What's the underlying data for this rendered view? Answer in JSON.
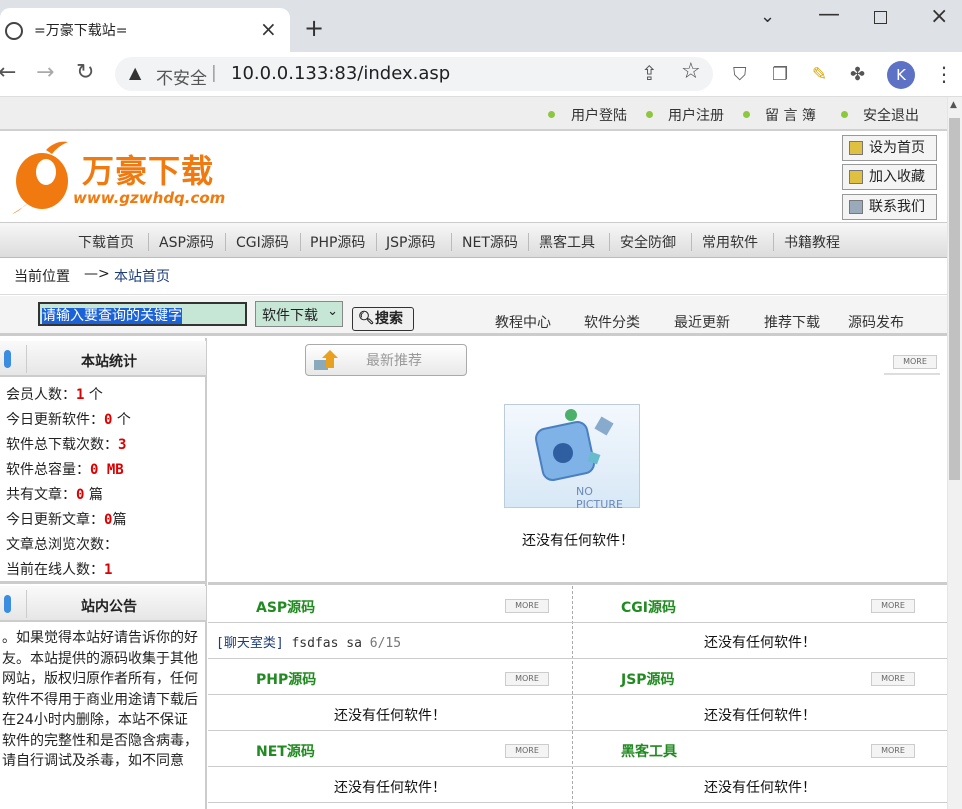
{
  "browser": {
    "tab_title": "=万豪下载站=",
    "insecure_label": "不安全",
    "url": "10.0.0.133:83/index.asp",
    "avatar_letter": "K"
  },
  "top_links": [
    "用户登陆",
    "用户注册",
    "留 言 簿",
    "安全退出"
  ],
  "logo": {
    "text": "万豪下载",
    "url_text": "www.gzwhdq.com"
  },
  "side_buttons": [
    "设为首页",
    "加入收藏",
    "联系我们"
  ],
  "categories": [
    "下载首页",
    "ASP源码",
    "CGI源码",
    "PHP源码",
    "JSP源码",
    "NET源码",
    "黑客工具",
    "安全防御",
    "常用软件",
    "书籍教程"
  ],
  "breadcrumb": {
    "label": "当前位置",
    "arrow": "—>",
    "current": "本站首页"
  },
  "search": {
    "input_value": "请输入要查询的关键字",
    "select_value": "软件下载",
    "button": "搜索",
    "links": [
      "教程中心",
      "软件分类",
      "最近更新",
      "推荐下载",
      "源码发布"
    ]
  },
  "stats": {
    "title": "本站统计",
    "rows": [
      {
        "label": "会员人数：",
        "value": "1",
        "unit": " 个"
      },
      {
        "label": "今日更新软件：",
        "value": "0",
        "unit": " 个"
      },
      {
        "label": "软件总下载次数：",
        "value": "3",
        "unit": ""
      },
      {
        "label": "软件总容量：",
        "value": "0 MB",
        "unit": ""
      },
      {
        "label": "共有文章：",
        "value": "0",
        "unit": " 篇"
      },
      {
        "label": "今日更新文章：",
        "value": "0",
        "unit": "篇"
      },
      {
        "label": "文章总浏览次数：",
        "value": "",
        "unit": ""
      },
      {
        "label": "当前在线人数：",
        "value": "1",
        "unit": ""
      }
    ]
  },
  "notice": {
    "title": "站内公告",
    "text": "。如果觉得本站好请告诉你的好友。本站提供的源码收集于其他网站，版权归原作者所有，任何软件不得用于商业用途请下载后在24小时内删除，本站不保证软件的完整性和是否隐含病毒，请自行调试及杀毒，如不同意"
  },
  "recommend": {
    "title": "最新推荐",
    "more": "MORE",
    "nopic": "NO PICTURE",
    "empty": "还没有任何软件！"
  },
  "sections": [
    {
      "name": "ASP源码",
      "items": [
        {
          "cat": "[聊天室类]",
          "title": " fsdfas sa ",
          "date": "6/15"
        }
      ],
      "empty": ""
    },
    {
      "name": "CGI源码",
      "items": [],
      "empty": "还没有任何软件！"
    },
    {
      "name": "PHP源码",
      "items": [],
      "empty": "还没有任何软件！"
    },
    {
      "name": "JSP源码",
      "items": [],
      "empty": "还没有任何软件！"
    },
    {
      "name": "NET源码",
      "items": [],
      "empty": "还没有任何软件！"
    },
    {
      "name": "黑客工具",
      "items": [],
      "empty": "还没有任何软件！"
    }
  ],
  "colors": {
    "accent_green": "#218a21",
    "stat_red": "#dd0000",
    "logo_orange": "#f07a10"
  }
}
